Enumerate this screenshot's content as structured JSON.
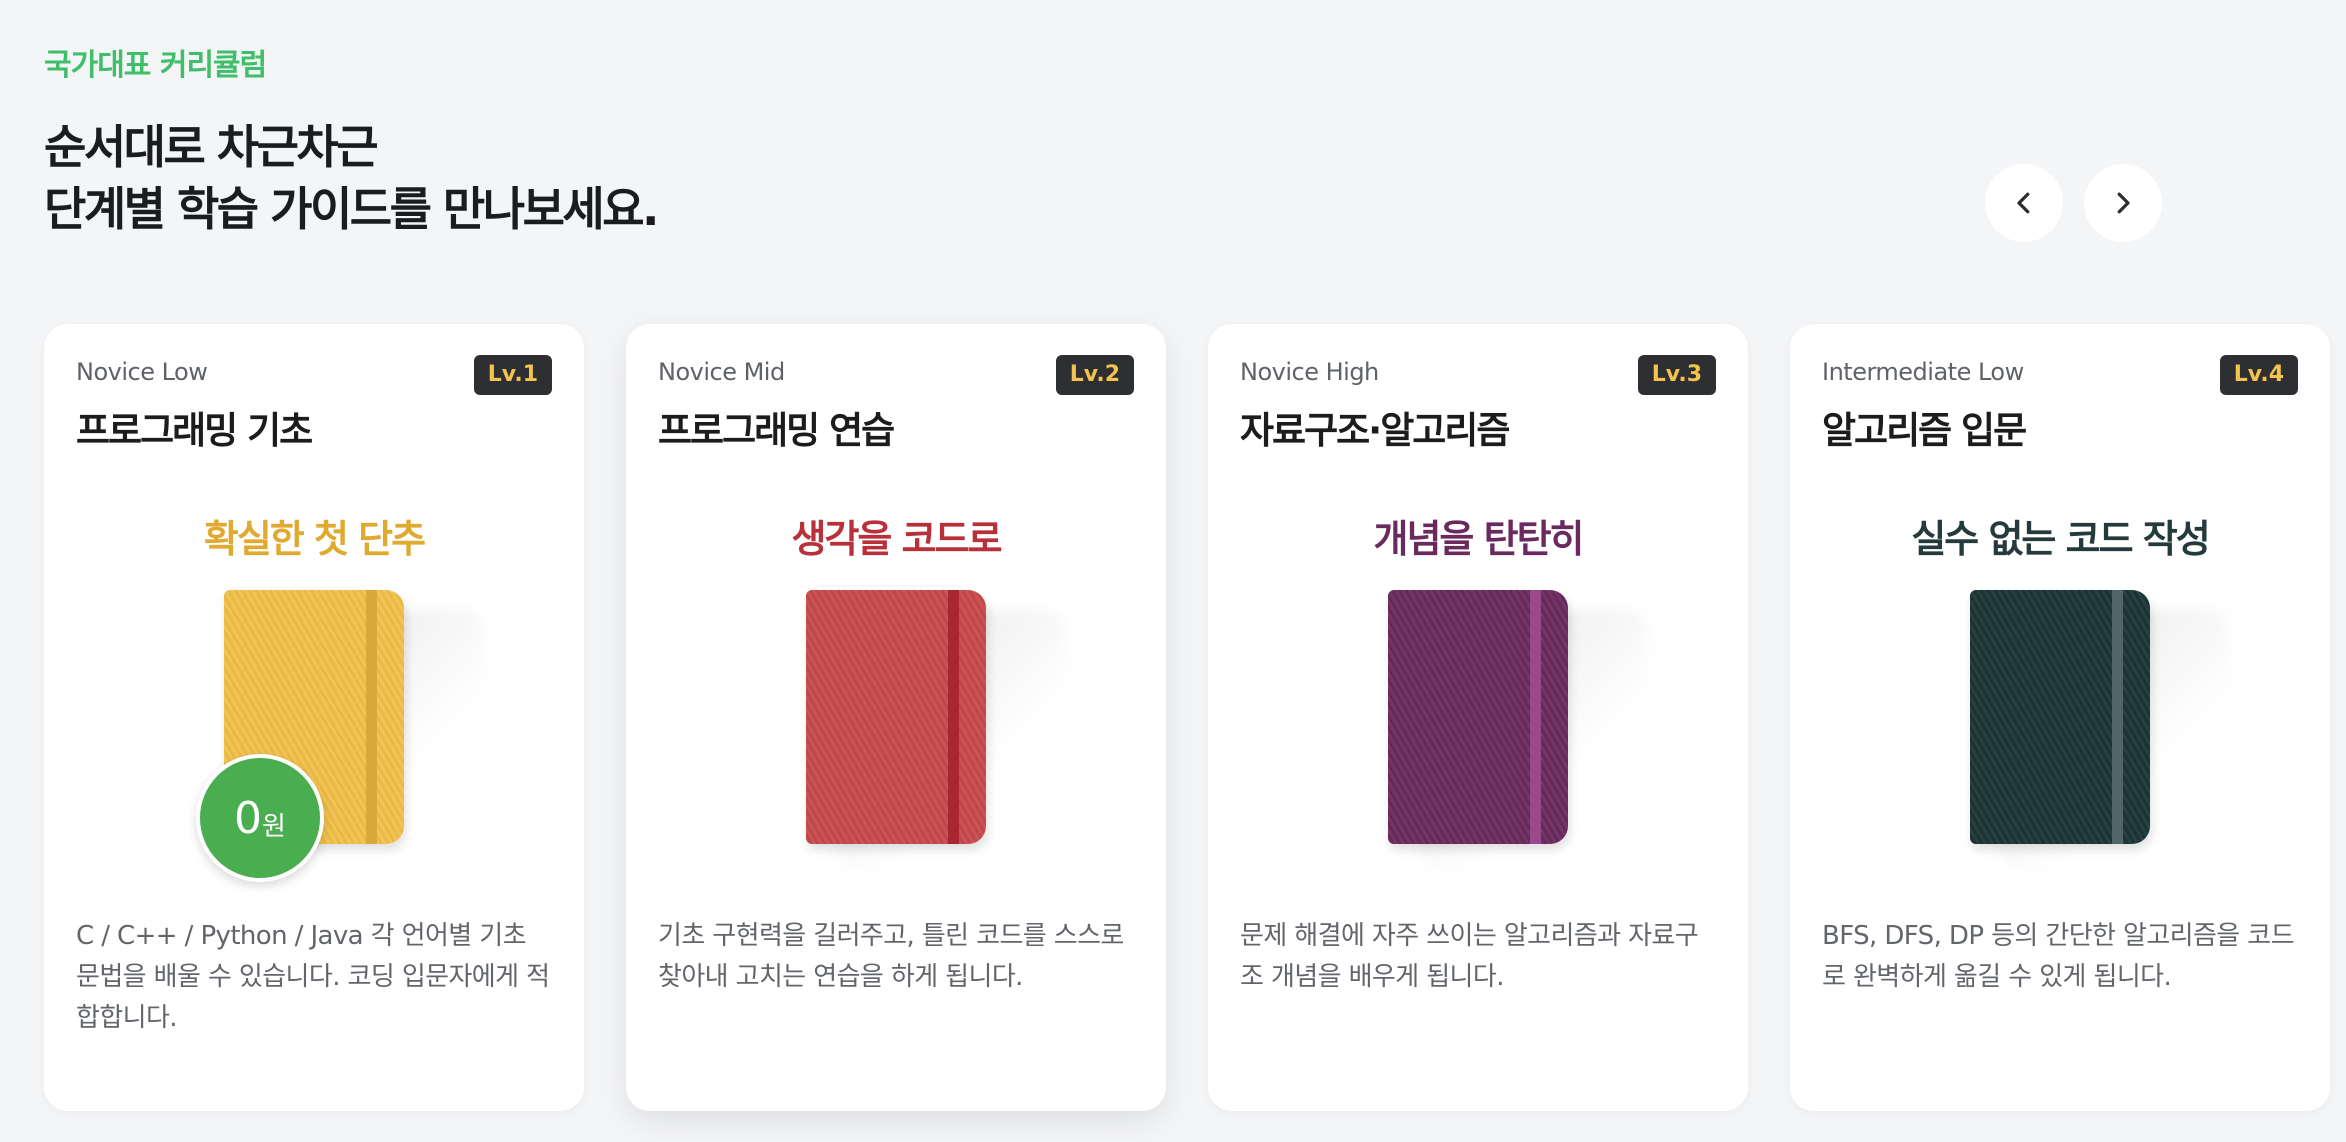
{
  "section": {
    "eyebrow": "국가대표 커리큘럼",
    "headline_line1": "순서대로 차근차근",
    "headline_line2": "단계별 학습 가이드를 만나보세요."
  },
  "nav": {
    "prev_icon": "chevron-left-icon",
    "next_icon": "chevron-right-icon"
  },
  "cards": [
    {
      "level": "Novice Low",
      "badge": "Lv.1",
      "title": "프로그래밍 기초",
      "tagline": "확실한 첫 단추",
      "tagline_color": "#e0a92f",
      "book_color": "#f2c14a",
      "band_color": "#d9a73a",
      "price": {
        "amount": "0",
        "unit": "원"
      },
      "description": "C / C++ / Python / Java 각 언어별 기초 문법을 배울 수 있습니다. 코딩 입문자에게 적합합니다."
    },
    {
      "level": "Novice Mid",
      "badge": "Lv.2",
      "title": "프로그래밍 연습",
      "tagline": "생각을 코드로",
      "tagline_color": "#b8303a",
      "book_color": "#c84a4d",
      "band_color": "#a82832",
      "description": "기초 구현력을 길러주고, 틀린 코드를 스스로 찾아내 고치는 연습을 하게 됩니다."
    },
    {
      "level": "Novice High",
      "badge": "Lv.3",
      "title": "자료구조·알고리즘",
      "tagline": "개념을 탄탄히",
      "tagline_color": "#6a2a5e",
      "book_color": "#6b2a5e",
      "band_color": "#9a4a8c",
      "description": "문제 해결에 자주 쓰이는 알고리즘과 자료구조 개념을 배우게 됩니다."
    },
    {
      "level": "Intermediate Low",
      "badge": "Lv.4",
      "title": "알고리즘 입문",
      "tagline": "실수 없는 코드 작성",
      "tagline_color": "#243a3c",
      "book_color": "#1c3536",
      "band_color": "#526669",
      "description": "BFS, DFS, DP 등의 간단한 알고리즘을 코드로 완벽하게 옮길 수 있게 됩니다."
    }
  ]
}
